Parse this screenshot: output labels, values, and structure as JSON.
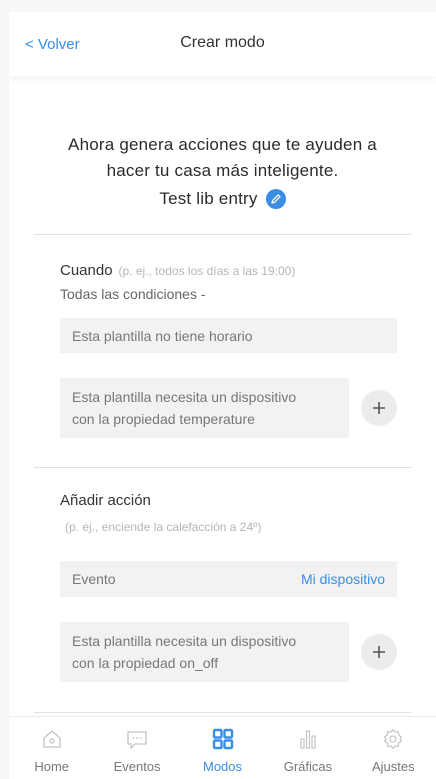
{
  "header": {
    "back_label": "< Volver",
    "title": "Crear modo"
  },
  "intro": {
    "line1": "Ahora genera acciones que te ayuden a",
    "line2": "hacer tu casa más inteligente.",
    "entry_name": "Test lib entry"
  },
  "when": {
    "title": "Cuando",
    "hint": "(p. ej., todos los días a las 19:00)",
    "conditions": "Todas las condiciones -",
    "schedule_box": "Esta plantilla no tiene horario",
    "device_box_line1": "Esta plantilla necesita un dispositivo",
    "device_box_line2": "con la propiedad temperature"
  },
  "action": {
    "title": "Añadir acción",
    "hint": "(p. ej., enciende la calefacción a 24º)",
    "event_label": "Evento",
    "event_link": "Mi dispositivo",
    "device_box_line1": "Esta plantilla necesita un dispositivo",
    "device_box_line2": "con la propiedad on_off"
  },
  "nav": {
    "items": [
      {
        "label": "Home",
        "icon": "home-icon"
      },
      {
        "label": "Eventos",
        "icon": "chat-icon"
      },
      {
        "label": "Modos",
        "icon": "grid-icon"
      },
      {
        "label": "Gráficas",
        "icon": "bar-chart-icon"
      },
      {
        "label": "Ajustes",
        "icon": "gear-icon"
      }
    ],
    "active_index": 2
  },
  "colors": {
    "accent": "#3a8ee6",
    "box_bg": "#f2f2f2",
    "icon_gray": "#c4c4c4"
  }
}
